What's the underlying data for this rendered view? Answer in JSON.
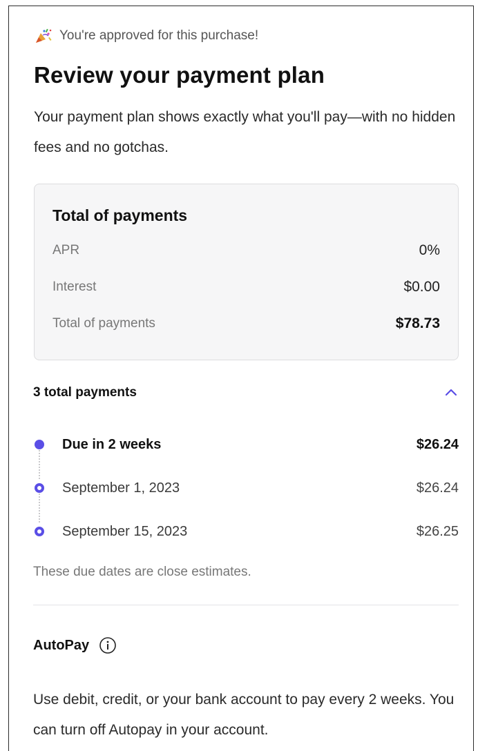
{
  "approval_text": "You're approved for this purchase!",
  "approval_icon": "party-popper-icon",
  "title": "Review your payment plan",
  "subtitle": "Your payment plan shows exactly what you'll pay—with no hidden fees and no gotchas.",
  "summary": {
    "title": "Total of payments",
    "rows": [
      {
        "label": "APR",
        "value": "0%"
      },
      {
        "label": "Interest",
        "value": "$0.00"
      },
      {
        "label": "Total of payments",
        "value": "$78.73"
      }
    ]
  },
  "payments": {
    "header": "3 total payments",
    "toggle_icon": "chevron-up-icon",
    "items": [
      {
        "date": "Due in 2 weeks",
        "amount": "$26.24"
      },
      {
        "date": "September 1, 2023",
        "amount": "$26.24"
      },
      {
        "date": "September 15, 2023",
        "amount": "$26.25"
      }
    ],
    "note": "These due dates are close estimates."
  },
  "autopay": {
    "label": "AutoPay",
    "info_icon": "info-icon",
    "description": "Use debit, credit, or your bank account to pay every 2 weeks. You can turn off Autopay in your account."
  },
  "colors": {
    "accent": "#5a4ee6",
    "summary_bg": "#f6f6f7",
    "muted_text": "#777777"
  }
}
